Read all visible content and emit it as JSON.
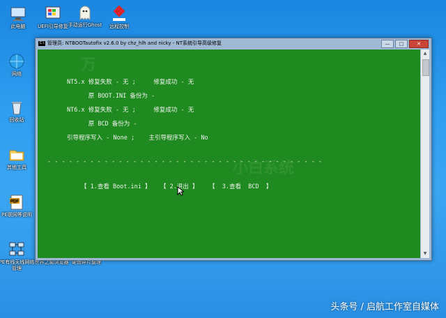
{
  "desktop": {
    "icons": [
      {
        "label": "此电脑"
      },
      {
        "label": "UEFI引导修复"
      },
      {
        "label": "手动运行Ghost"
      },
      {
        "label": "远程控制"
      },
      {
        "label": "网络"
      },
      {
        "label": "回收站"
      },
      {
        "label": "其他工具"
      },
      {
        "label": "PE联网等说明"
      },
      {
        "label": "PE有线无线网络管理"
      },
      {
        "label": "世界之窗浏览器"
      },
      {
        "label": "硬盘碎片整理"
      }
    ]
  },
  "window": {
    "title": "管理员: NTBOOTautofix v2.6.0 by chz_hlh and nicky - NT系统引导高级修复",
    "app_icon_text": "C:\\",
    "controls": {
      "minimize": "—",
      "maximize": "□",
      "close": "✕"
    }
  },
  "console": {
    "lines": [
      "NT5.x 修复失败 - 无 ;     修复成功 - 无",
      "      原 BOOT.INI 备份为 -",
      "NT6.x 修复失败 - 无 ;     修复成功 - 无",
      "      原 BCD 备份为 -",
      "引导程序写入 - None ;    主引导程序写入 - No"
    ],
    "separator": "- - - - - - - - - - - - - - - - - - - - - - - - - - - - - - - - - - - - - - -",
    "menu": [
      "【 1.查看 Boot.ini 】",
      "【 2.退出 】",
      "【  3.查看  BCD  】"
    ],
    "watermarks": [
      "万",
      "小白系统"
    ]
  },
  "footer_watermark": "头条号 / 启航工作室自媒体"
}
